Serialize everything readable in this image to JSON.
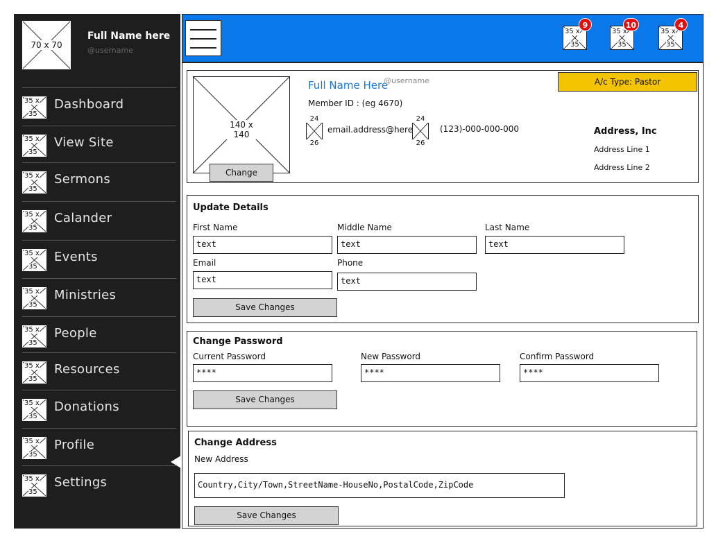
{
  "sidebar": {
    "avatar_caption": "70 x 70",
    "full_name": "Full Name here",
    "username": "@username",
    "items": [
      {
        "label": "Dashboard",
        "icon": "placeholder-image-icon",
        "icon_caption_top": "35 x",
        "icon_caption_bottom": "35"
      },
      {
        "label": "View Site",
        "icon": "placeholder-image-icon",
        "icon_caption_top": "35 x",
        "icon_caption_bottom": "35"
      },
      {
        "label": "Sermons",
        "icon": "placeholder-image-icon",
        "icon_caption_top": "35 x",
        "icon_caption_bottom": "35"
      },
      {
        "label": "Calander",
        "icon": "placeholder-image-icon",
        "icon_caption_top": "35 x",
        "icon_caption_bottom": "35"
      },
      {
        "label": "Events",
        "icon": "placeholder-image-icon",
        "icon_caption_top": "35 x",
        "icon_caption_bottom": "35"
      },
      {
        "label": "Ministries",
        "icon": "placeholder-image-icon",
        "icon_caption_top": "35 x",
        "icon_caption_bottom": "35"
      },
      {
        "label": "People",
        "icon": "placeholder-image-icon",
        "icon_caption_top": "35 x",
        "icon_caption_bottom": "35"
      },
      {
        "label": "Resources",
        "icon": "placeholder-image-icon",
        "icon_caption_top": "35 x",
        "icon_caption_bottom": "35"
      },
      {
        "label": "Donations",
        "icon": "placeholder-image-icon",
        "icon_caption_top": "35 x",
        "icon_caption_bottom": "35"
      },
      {
        "label": "Profile",
        "icon": "placeholder-image-icon",
        "icon_caption_top": "35 x",
        "icon_caption_bottom": "35",
        "active": true
      },
      {
        "label": "Settings",
        "icon": "placeholder-image-icon",
        "icon_caption_top": "35 x",
        "icon_caption_bottom": "35"
      }
    ]
  },
  "topbar": {
    "menu_icon": "hamburger-menu-icon",
    "color": "#0a78e8",
    "notifications": [
      {
        "icon_caption_top": "35 x",
        "icon_caption_bottom": "35",
        "badge": "9"
      },
      {
        "icon_caption_top": "35 x",
        "icon_caption_bottom": "35",
        "badge": "10"
      },
      {
        "icon_caption_top": "35 x",
        "icon_caption_bottom": "35",
        "badge": "4"
      }
    ]
  },
  "profile": {
    "picture_caption": "140 x 140",
    "change_label": "Change",
    "full_name": "Full Name Here",
    "username": "@username",
    "member_id": "Member ID : (eg 4670)",
    "email_icon_caption_top": "24",
    "email_icon_caption_bottom": "26",
    "email": "email.address@here",
    "phone_icon_caption_top": "24",
    "phone_icon_caption_bottom": "26",
    "phone": "(123)-000-000-000",
    "account_type": "A/c Type: Pastor",
    "account_type_color": "#f5c400",
    "address_company": "Address, Inc",
    "address_line1": "Address Line 1",
    "address_line2": "Address Line 2"
  },
  "update_details": {
    "title": "Update Details",
    "first_name_label": "First Name",
    "first_name_value": "text",
    "middle_name_label": "Middle Name",
    "middle_name_value": "text",
    "last_name_label": "Last Name",
    "last_name_value": "text",
    "email_label": "Email",
    "email_value": "text",
    "phone_label": "Phone",
    "phone_value": "text",
    "save_label": "Save Changes"
  },
  "change_password": {
    "title": "Change Password",
    "current_label": "Current Password",
    "current_value": "****",
    "new_label": "New Password",
    "new_value": "****",
    "confirm_label": "Confirm Password",
    "confirm_value": "****",
    "save_label": "Save Changes"
  },
  "change_address": {
    "title": "Change Address",
    "new_address_label": "New Address",
    "new_address_value": "Country,City/Town,StreetName-HouseNo,PostalCode,ZipCode",
    "save_label": "Save Changes"
  }
}
